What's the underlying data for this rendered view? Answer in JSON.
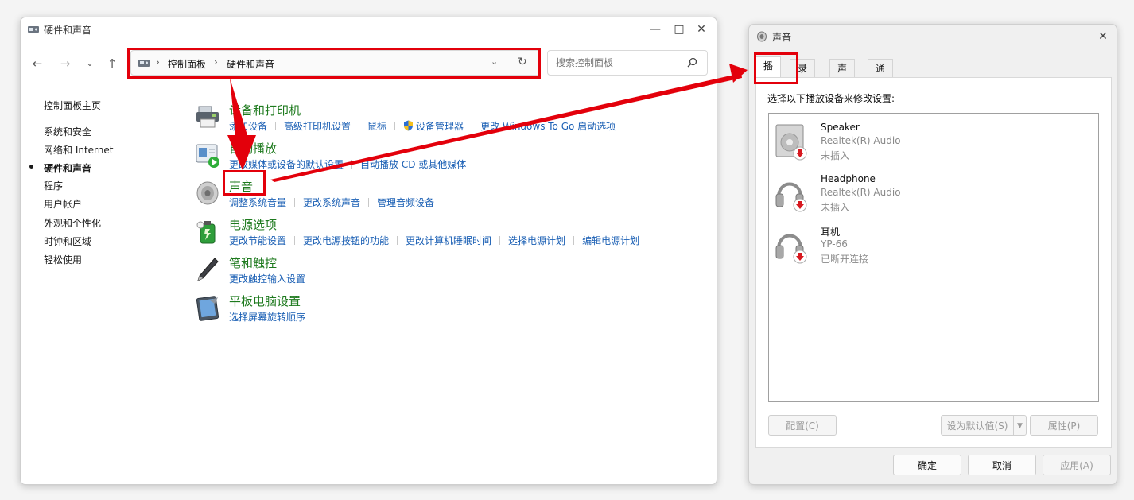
{
  "control_panel": {
    "title": "硬件和声音",
    "breadcrumb": [
      "控制面板",
      "硬件和声音"
    ],
    "search_placeholder": "搜索控制面板",
    "left_nav": [
      "控制面板主页",
      "系统和安全",
      "网络和 Internet",
      "硬件和声音",
      "程序",
      "用户帐户",
      "外观和个性化",
      "时钟和区域",
      "轻松使用"
    ],
    "active_nav": "硬件和声音",
    "categories": [
      {
        "title": "设备和打印机",
        "icon": "printer-icon",
        "links": [
          "添加设备",
          "高级打印机设置",
          "鼠标",
          "设备管理器",
          "更改 Windows To Go 启动选项"
        ]
      },
      {
        "title": "自动播放",
        "icon": "autoplay-icon",
        "links": [
          "更改媒体或设备的默认设置",
          "自动播放 CD 或其他媒体"
        ]
      },
      {
        "title": "声音",
        "icon": "speaker-icon",
        "links": [
          "调整系统音量",
          "更改系统声音",
          "管理音频设备"
        ]
      },
      {
        "title": "电源选项",
        "icon": "battery-icon",
        "links": [
          "更改节能设置",
          "更改电源按钮的功能",
          "更改计算机睡眠时间",
          "选择电源计划",
          "编辑电源计划"
        ]
      },
      {
        "title": "笔和触控",
        "icon": "pen-icon",
        "links": [
          "更改触控输入设置"
        ]
      },
      {
        "title": "平板电脑设置",
        "icon": "tablet-icon",
        "links": [
          "选择屏幕旋转顺序"
        ]
      }
    ]
  },
  "sound_dialog": {
    "title": "声音",
    "tabs": [
      "播放",
      "录制",
      "声音",
      "通信"
    ],
    "selected_tab": "播放",
    "instruction": "选择以下播放设备来修改设置:",
    "devices": [
      {
        "name": "Speaker",
        "driver": "Realtek(R) Audio",
        "status": "未插入",
        "icon": "speaker-device-icon"
      },
      {
        "name": "Headphone",
        "driver": "Realtek(R) Audio",
        "status": "未插入",
        "icon": "headphone-device-icon"
      },
      {
        "name": "耳机",
        "driver": "YP-66",
        "status": "已断开连接",
        "icon": "headphone-device-icon"
      }
    ],
    "buttons": {
      "configure": "配置(C)",
      "set_default": "设为默认值(S)",
      "properties": "属性(P)",
      "ok": "确定",
      "cancel": "取消",
      "apply": "应用(A)"
    }
  },
  "colors": {
    "annotation_red": "#e3000b",
    "link_blue": "#1a5fb4",
    "category_green": "#1e7a1e"
  }
}
